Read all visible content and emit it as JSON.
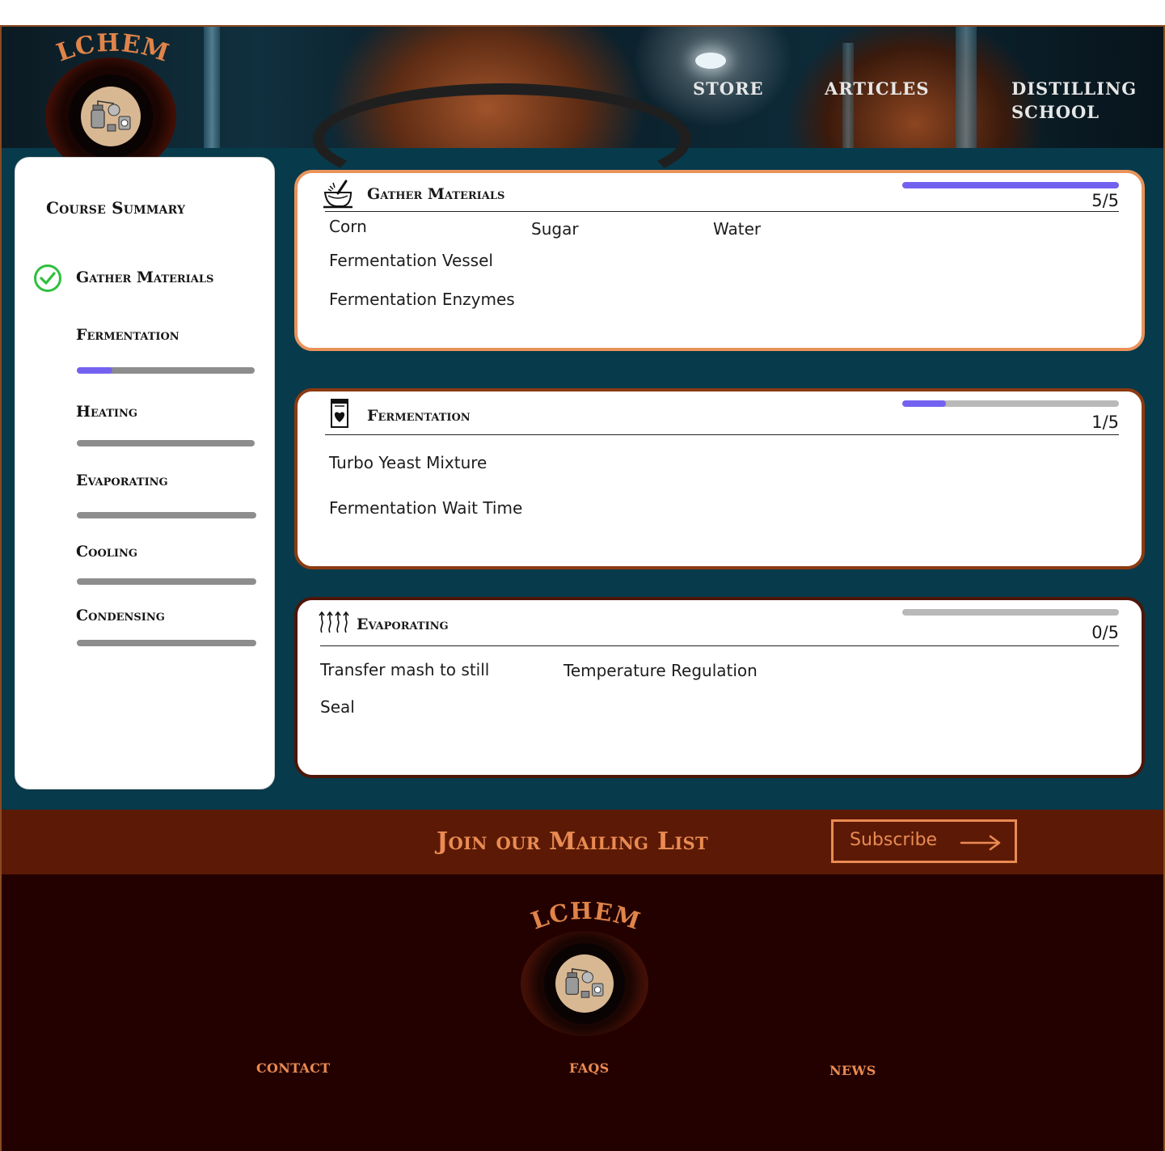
{
  "brand": {
    "name": "ALCHEMY",
    "accent": "#e0844a",
    "logo_icon": "distillery-apparatus-icon"
  },
  "nav": {
    "items": [
      "STORE",
      "ARTICLES",
      "DISTILLING",
      "SCHOOL"
    ],
    "distilling_school": [
      "DISTILLING",
      "SCHOOL"
    ]
  },
  "sidebar": {
    "title": "Course Summary",
    "items": [
      {
        "label": "Gather Materials",
        "status": "complete",
        "icon": "check-circle-icon"
      },
      {
        "label": "Fermentation",
        "progress": 0.2
      },
      {
        "label": "Heating",
        "progress": 0
      },
      {
        "label": "Evaporating",
        "progress": 0
      },
      {
        "label": "Cooling",
        "progress": 0
      },
      {
        "label": "Condensing",
        "progress": 0
      }
    ]
  },
  "cards": [
    {
      "title": "Gather Materials",
      "icon": "mortar-pestle-icon",
      "count": "5/5",
      "progress": 1.0,
      "border": "#e9935b",
      "items": [
        "Corn",
        "Sugar",
        "Water",
        "Fermentation Vessel",
        "Fermentation Enzymes"
      ]
    },
    {
      "title": "Fermentation",
      "icon": "fermentation-jar-icon",
      "count": "1/5",
      "progress": 0.2,
      "border": "#8c3a12",
      "items": [
        "Turbo Yeast Mixture",
        "Fermentation Wait Time"
      ]
    },
    {
      "title": "Evaporating",
      "icon": "rising-vapor-icon",
      "count": "0/5",
      "progress": 0,
      "border": "#4d1608",
      "items": [
        "Transfer mash to still",
        "Temperature Regulation",
        "Seal"
      ]
    }
  ],
  "mailing": {
    "title": "Join our Mailing List",
    "button_label": "Subscribe",
    "button_icon": "arrow-right-icon"
  },
  "footer": {
    "brand": "ALCHEMY",
    "links": [
      "CONTACT",
      "FAQS",
      "NEWS"
    ]
  },
  "colors": {
    "page_bg": "#073a4a",
    "progress_fill": "#7362f0",
    "progress_track": "#8d8d8d",
    "mail_band": "#5c1a06",
    "footer_bg": "#230100",
    "link": "#e98b52",
    "check": "#2fbf3c"
  }
}
